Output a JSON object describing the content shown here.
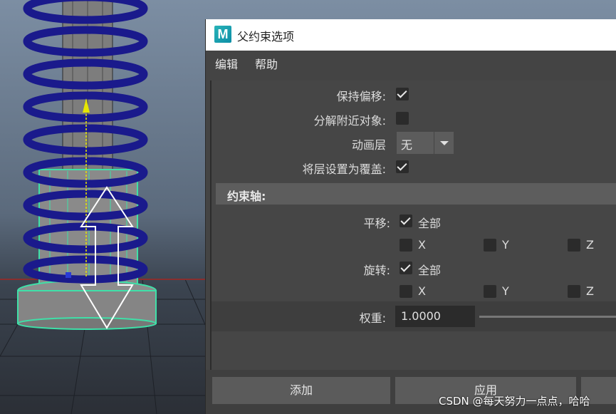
{
  "dialog": {
    "app_icon_letter": "M",
    "title": "父约束选项",
    "menu": {
      "edit": "编辑",
      "help": "帮助"
    },
    "options": {
      "maintain_offset": {
        "label": "保持偏移:",
        "checked": true
      },
      "decompose_target": {
        "label": "分解附近对象:",
        "checked": false
      },
      "anim_layer": {
        "label": "动画层",
        "value": "无"
      },
      "layer_override": {
        "label": "将层设置为覆盖:",
        "checked": true
      }
    },
    "constraint_axes": {
      "title": "约束轴:",
      "translate": {
        "label": "平移:",
        "all_label": "全部",
        "all_checked": true,
        "x": "X",
        "y": "Y",
        "z": "Z"
      },
      "rotate": {
        "label": "旋转:",
        "all_label": "全部",
        "all_checked": true,
        "x": "X",
        "y": "Y",
        "z": "Z"
      }
    },
    "weight": {
      "label": "权重:",
      "value": "1.0000"
    },
    "buttons": {
      "add": "添加",
      "apply": "应用"
    }
  },
  "watermark": "CSDN @每天努力一点点，哈哈",
  "colors": {
    "spring": "#1a1a8c",
    "selection": "#3fe0a8",
    "manipulator": "#ffffff",
    "axis": "#e6e600"
  }
}
